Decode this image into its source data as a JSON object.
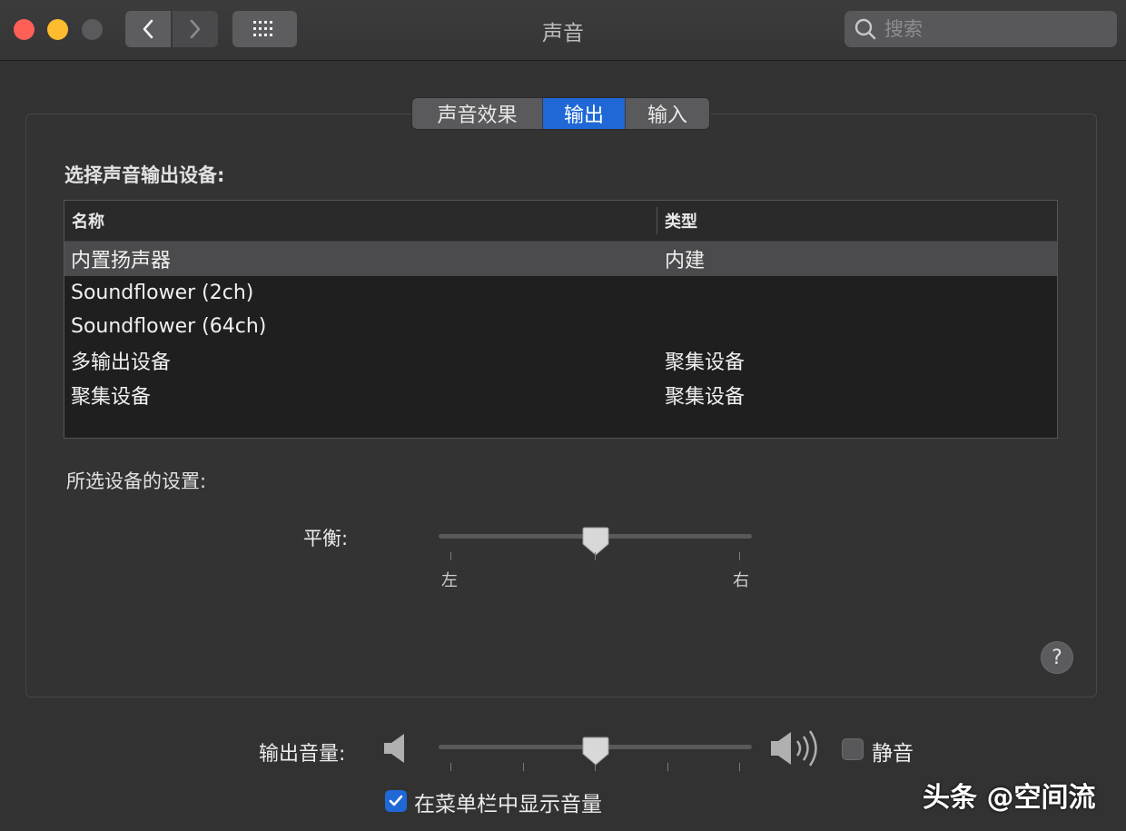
{
  "window": {
    "title": "声音"
  },
  "search": {
    "placeholder": "搜索"
  },
  "tabs": [
    {
      "label": "声音效果",
      "selected": false
    },
    {
      "label": "输出",
      "selected": true
    },
    {
      "label": "输入",
      "selected": false
    }
  ],
  "output": {
    "select_label": "选择声音输出设备:",
    "columns": {
      "name": "名称",
      "type": "类型"
    },
    "devices": [
      {
        "name": "内置扬声器",
        "type": "内建",
        "selected": true
      },
      {
        "name": "Soundflower (2ch)",
        "type": ""
      },
      {
        "name": "Soundflower (64ch)",
        "type": ""
      },
      {
        "name": "多输出设备",
        "type": "聚集设备"
      },
      {
        "name": "聚集设备",
        "type": "聚集设备"
      }
    ],
    "settings_label": "所选设备的设置:",
    "balance": {
      "label": "平衡:",
      "left": "左",
      "right": "右",
      "value": 0.5
    }
  },
  "help": {
    "label": "?"
  },
  "volume": {
    "label": "输出音量:",
    "value": 0.5,
    "mute_label": "静音",
    "mute_checked": false,
    "show_in_menubar_label": "在菜单栏中显示音量",
    "show_in_menubar_checked": true
  },
  "watermark": "头条 @空间流",
  "colors": {
    "accent": "#1f68d6",
    "background": "#323233"
  }
}
